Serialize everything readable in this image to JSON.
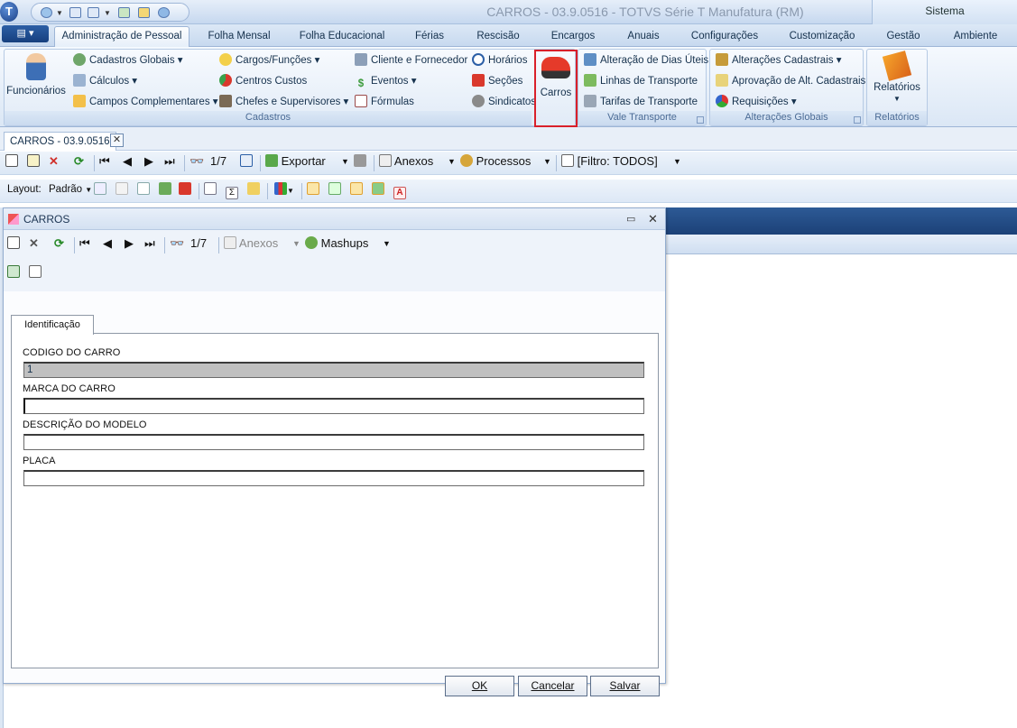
{
  "window": {
    "title": "CARROS - 03.9.0516 - TOTVS Série T Manufatura (RM)",
    "sistema": "Sistema"
  },
  "app_orb": "T",
  "ribbon_tabs": [
    "Administração de Pessoal",
    "Folha Mensal",
    "Folha Educacional",
    "Férias",
    "Rescisão",
    "Encargos",
    "Anuais",
    "Configurações",
    "Customização",
    "Gestão",
    "Ambiente"
  ],
  "ribbon": {
    "funcionarios": "Funcionários",
    "cadastros_col1": [
      "Cadastros Globais ▾",
      "Cálculos ▾",
      "Campos Complementares ▾"
    ],
    "cadastros_col2": [
      "Cargos/Funções ▾",
      "Centros Custos",
      "Chefes e Supervisores ▾"
    ],
    "cadastros_col3": [
      "Cliente e Fornecedor",
      "Eventos ▾",
      "Fórmulas"
    ],
    "cadastros_col4": [
      "Horários",
      "Seções",
      "Sindicatos"
    ],
    "cadastros_label": "Cadastros",
    "carros": "Carros",
    "vale": [
      "Alteração de Dias Úteis",
      "Linhas de Transporte",
      "Tarifas de Transporte"
    ],
    "vale_label": "Vale Transporte",
    "alteracoes": [
      "Alterações Cadastrais ▾",
      "Aprovação de Alt. Cadastrais",
      "Requisições ▾"
    ],
    "alteracoes_label": "Alterações Globais",
    "relatorios": "Relatórios",
    "relatorios_label": "Relatórios"
  },
  "doc_tab": {
    "label": "CARROS - 03.9.0516",
    "close": "✕"
  },
  "toolbar1": {
    "position": "1/7",
    "exportar": "Exportar",
    "anexos": "Anexos",
    "processos": "Processos",
    "filtro": "[Filtro: TODOS]"
  },
  "toolbar2": {
    "layout_label": "Layout:",
    "layout_value": "Padrão"
  },
  "dialog": {
    "title": "CARROS",
    "position": "1/7",
    "anexos": "Anexos",
    "mashups": "Mashups",
    "tab": "Identificação",
    "fields": [
      {
        "label": "CODIGO DO CARRO",
        "value": "1"
      },
      {
        "label": "MARCA DO CARRO",
        "value": ""
      },
      {
        "label": "DESCRIÇÃO DO MODELO",
        "value": ""
      },
      {
        "label": "PLACA",
        "value": ""
      }
    ],
    "buttons": {
      "ok": "OK",
      "cancel": "Cancelar",
      "save": "Salvar"
    }
  },
  "colors": {
    "accent": "#1c4178",
    "highlight_border": "#d9202a"
  }
}
